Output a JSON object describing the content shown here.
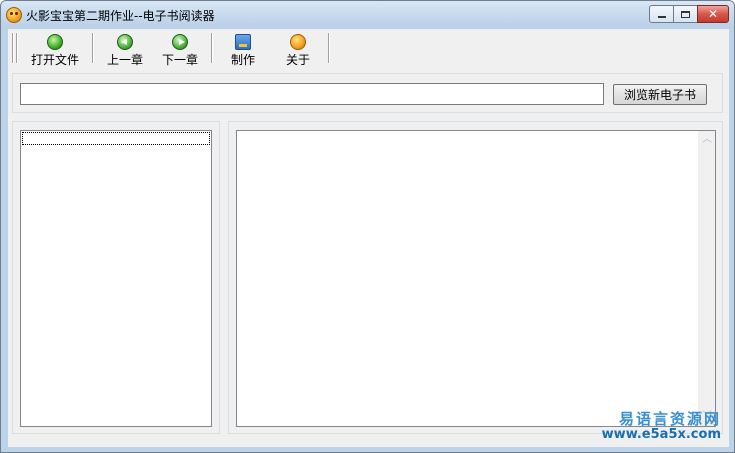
{
  "window": {
    "title": "火影宝宝第二期作业--电子书阅读器",
    "icon": "app-face-icon"
  },
  "toolbar": {
    "buttons": [
      {
        "label": "打开文件",
        "icon": "open-file-icon"
      },
      {
        "label": "上一章",
        "icon": "prev-chapter-icon"
      },
      {
        "label": "下一章",
        "icon": "next-chapter-icon"
      },
      {
        "label": "制作",
        "icon": "make-book-icon"
      },
      {
        "label": "关于",
        "icon": "about-icon"
      }
    ]
  },
  "path_bar": {
    "value": "",
    "browse_label": "浏览新电子书"
  },
  "watermark": {
    "line1": "易语言资源网",
    "line2": "www.e5a5x.com"
  }
}
